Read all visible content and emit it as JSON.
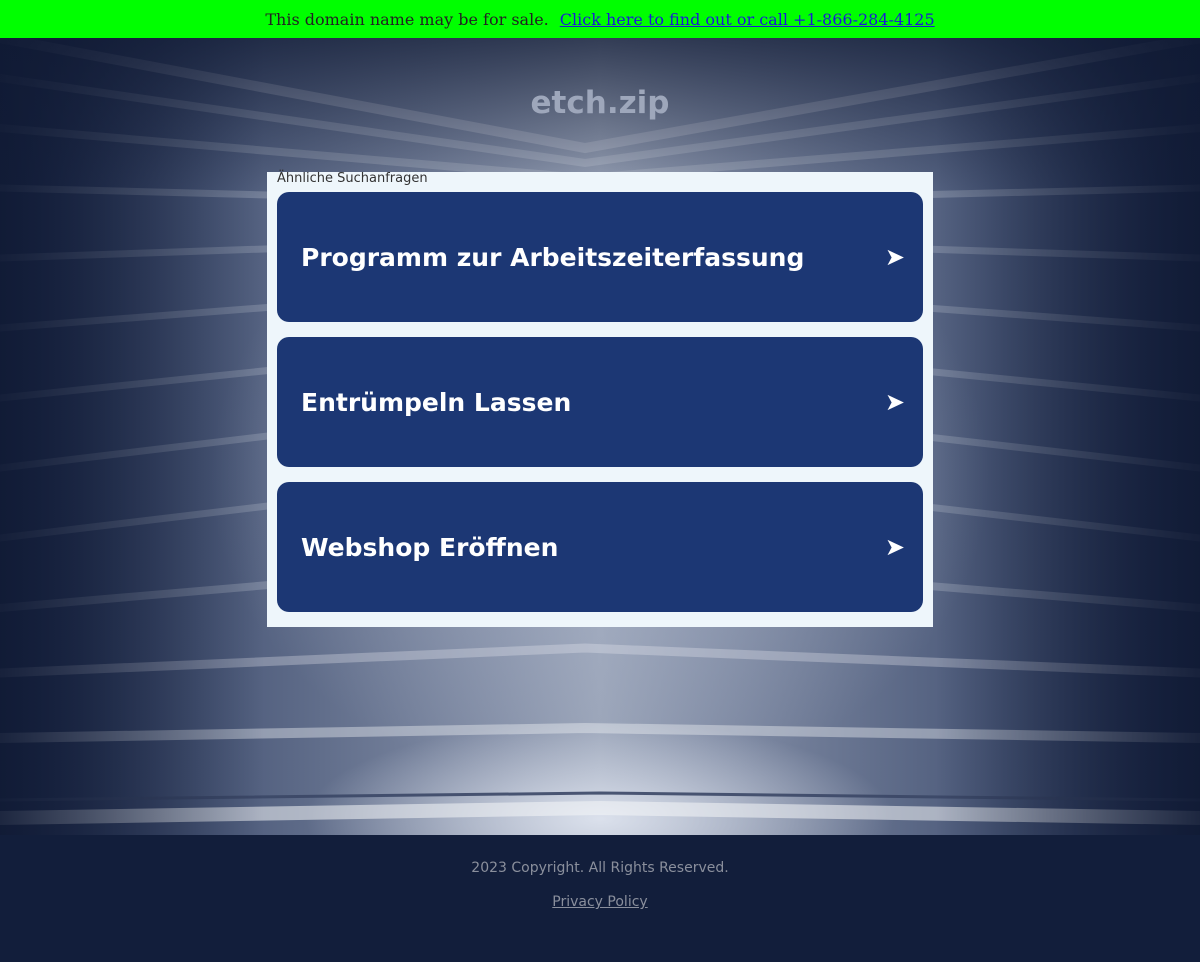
{
  "sale_bar": {
    "text": "This domain name may be for sale.",
    "link": "Click here to find out or call +1-866-284-4125"
  },
  "site": {
    "title": "etch.zip"
  },
  "related": {
    "heading": "Ähnliche Suchanfragen",
    "items": [
      {
        "label": "Programm zur Arbeitszeiterfassung",
        "arrow": "➤"
      },
      {
        "label": "Entrümpeln Lassen",
        "arrow": "➤"
      },
      {
        "label": "Webshop Eröffnen",
        "arrow": "➤"
      }
    ]
  },
  "footer": {
    "copyright": "2023 Copyright. All Rights Reserved.",
    "privacy": "Privacy Policy"
  },
  "colors": {
    "sale_bar": "#00ff00",
    "card": "#1c3774",
    "panel": "#eef6fb",
    "footer": "#121e3b"
  }
}
